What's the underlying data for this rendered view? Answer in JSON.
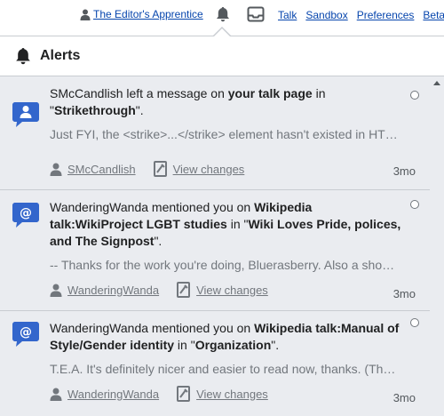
{
  "personal_tools": {
    "username": "The Editor's Apprentice",
    "links": [
      "Talk",
      "Sandbox",
      "Preferences",
      "Beta"
    ]
  },
  "popup": {
    "title": "Alerts"
  },
  "notifications": [
    {
      "type_icon": "talk-message-icon",
      "header": [
        {
          "text": "SMcCandlish left a message on ",
          "bold": false
        },
        {
          "text": "your talk page",
          "bold": true
        },
        {
          "text": " in \"",
          "bold": false
        },
        {
          "text": "Strikethrough",
          "bold": true
        },
        {
          "text": "\".",
          "bold": false
        }
      ],
      "excerpt": "Just FYI, the <strike>...</strike> element hasn't existed in HTML for many years",
      "agent": "SMcCandlish",
      "view_changes": "View changes",
      "timestamp": "3mo"
    },
    {
      "type_icon": "mention-icon",
      "header": [
        {
          "text": "WanderingWanda mentioned you on ",
          "bold": false
        },
        {
          "text": "Wikipedia talk:WikiProject LGBT studies",
          "bold": true
        },
        {
          "text": " in \"",
          "bold": false
        },
        {
          "text": "Wiki Loves Pride, polices, and The Signpost",
          "bold": true
        },
        {
          "text": "\".",
          "bold": false
        }
      ],
      "excerpt": "-- Thanks for the work you're doing, Bluerasberry. Also a should mention",
      "agent": "WanderingWanda",
      "view_changes": "View changes",
      "timestamp": "3mo"
    },
    {
      "type_icon": "mention-icon",
      "header": [
        {
          "text": "WanderingWanda mentioned you on ",
          "bold": false
        },
        {
          "text": "Wikipedia talk:Manual of Style/Gender identity",
          "bold": true
        },
        {
          "text": " in \"",
          "bold": false
        },
        {
          "text": "Organization",
          "bold": true
        },
        {
          "text": "\".",
          "bold": false
        }
      ],
      "excerpt": "T.E.A. It's definitely nicer and easier to read now, thanks. (Though it's",
      "agent": "WanderingWanda",
      "view_changes": "View changes",
      "timestamp": "3mo"
    }
  ],
  "colors": {
    "link": "#0645ad",
    "icon_blue": "#3366cc",
    "item_bg": "#eaecf0",
    "excerpt_gray": "#72777d"
  }
}
